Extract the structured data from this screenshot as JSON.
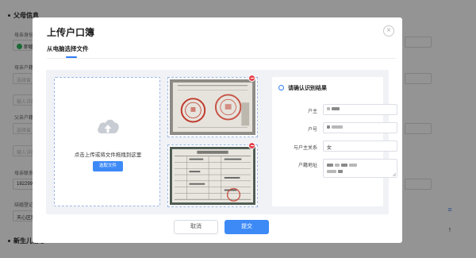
{
  "background": {
    "section_parents": "父母信息",
    "section_newborn": "新生儿信息",
    "label_mother_id": "母亲身份证",
    "mother_marriage": "即婚",
    "label_mother_household": "母亲户籍地",
    "placeholder_select": "选择省",
    "placeholder_detail": "输入详细",
    "label_father_household": "父亲户籍地",
    "label_mother_phone": "母亲联系电",
    "mother_phone": "18229953",
    "label_marriage_office": "结婚登记机",
    "marriage_office": "天心区民政",
    "side_icon_menu": "≡",
    "side_icon_top": "↑"
  },
  "modal": {
    "title": "上传户口簿",
    "close_glyph": "×",
    "tab_label": "从电脑选择文件",
    "drop_text": "点击上传或将文件拖拽到这里",
    "pick_button": "选取文件",
    "result_title": "请确认识别结果",
    "fields": [
      {
        "label": "户主",
        "value": ""
      },
      {
        "label": "户号",
        "value": ""
      },
      {
        "label": "与户主关系",
        "value": "女"
      },
      {
        "label": "户籍地址",
        "value": ""
      }
    ],
    "cancel_label": "取消",
    "submit_label": "提交"
  },
  "colors": {
    "accent": "#3d8af7",
    "danger": "#e5414b",
    "stamp": "#c0392b"
  }
}
